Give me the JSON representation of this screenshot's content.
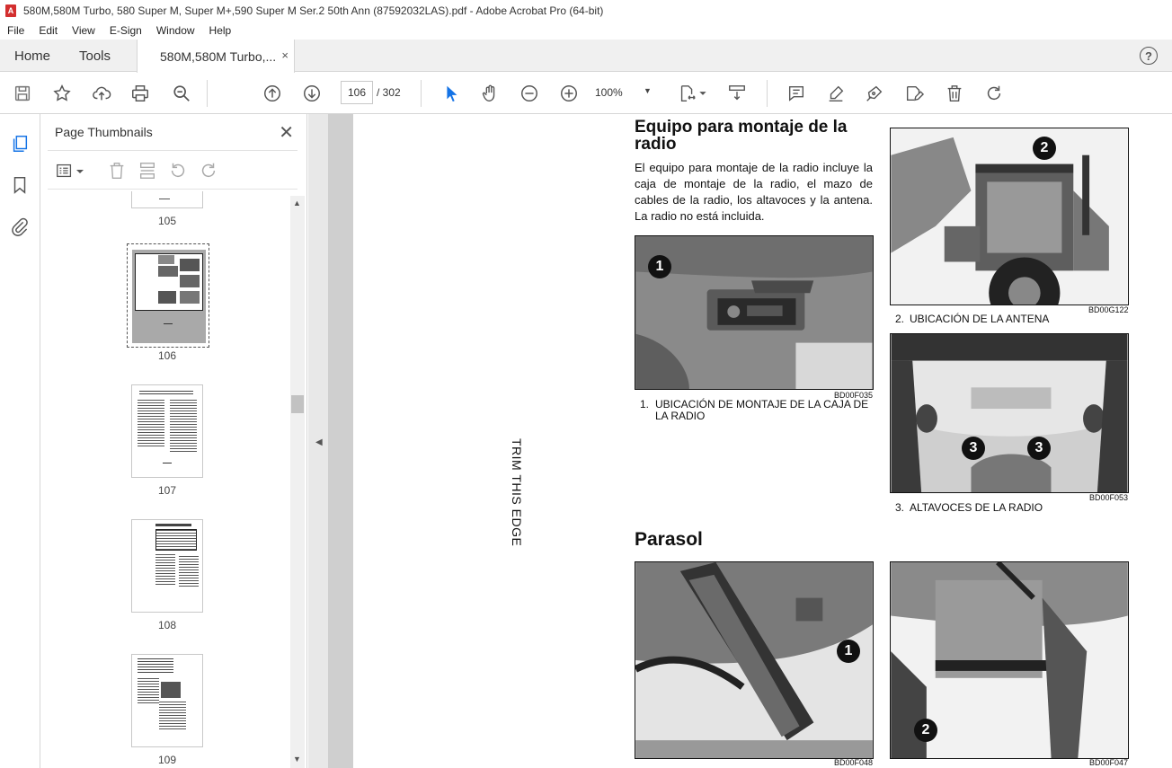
{
  "window": {
    "title": "580M,580M Turbo, 580 Super M, Super M+,590 Super M Ser.2 50th Ann (87592032LAS).pdf - Adobe Acrobat Pro (64-bit)"
  },
  "menu": [
    "File",
    "Edit",
    "View",
    "E-Sign",
    "Window",
    "Help"
  ],
  "tabs": {
    "home": "Home",
    "tools": "Tools",
    "document": "580M,580M Turbo,...",
    "close_symbol": "×",
    "help_symbol": "?"
  },
  "toolbar": {
    "page_current": "106",
    "page_total": "/ 302",
    "zoom": "100%",
    "icons": [
      "save-icon",
      "star-icon",
      "upload-icon",
      "print-icon",
      "zoom-search-icon",
      "page-up-icon",
      "page-down-icon",
      "select-arrow-icon",
      "hand-icon",
      "zoom-out-icon",
      "zoom-in-icon",
      "fit-page-icon",
      "scroll-mode-icon",
      "comment-icon",
      "highlight-icon",
      "sign-icon",
      "fill-sign-icon",
      "delete-icon",
      "redo-icon"
    ]
  },
  "thumbnails_panel": {
    "title": "Page Thumbnails",
    "pages": [
      "105",
      "106",
      "107",
      "108",
      "109"
    ],
    "selected_page": "106"
  },
  "document": {
    "trim_text": "TRIM THIS EDGE",
    "section1": {
      "title": "Equipo para montaje de la radio",
      "body": "El equipo para montaje de la radio incluye la caja de montaje de la radio, el mazo de cables de la radio, los altavoces y la antena. La radio no está incluida."
    },
    "figures": [
      {
        "code": "BD00F035",
        "caption_num": "1.",
        "caption": "UBICACIÓN DE MONTAJE DE LA CAJA DE LA RADIO",
        "callouts": [
          "1"
        ]
      },
      {
        "code": "BD00G122",
        "caption_num": "2.",
        "caption": "UBICACIÓN DE LA ANTENA",
        "callouts": [
          "2"
        ]
      },
      {
        "code": "BD00F053",
        "caption_num": "3.",
        "caption": "ALTAVOCES DE LA RADIO",
        "callouts": [
          "3",
          "3"
        ]
      },
      {
        "code": "BD00F048",
        "caption_num": "",
        "caption": "",
        "callouts": [
          "1"
        ]
      },
      {
        "code": "BD00F047",
        "caption_num": "",
        "caption": "",
        "callouts": [
          "2"
        ]
      }
    ],
    "section2": {
      "title": "Parasol"
    }
  },
  "colors": {
    "panel_border": "#d6d6d6",
    "doc_background": "#cfcfcf",
    "select_arrow": "#1473e6"
  }
}
